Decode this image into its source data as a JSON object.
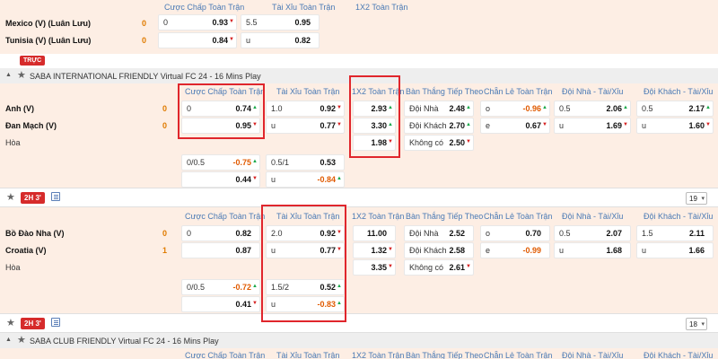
{
  "top_headers": {
    "hdcp": "Cược Chấp Toàn Trận",
    "ou": "Tài Xỉu Toàn Trận",
    "x12": "1X2 Toàn Trận"
  },
  "match0": {
    "home": "Mexico (V) (Luân Lưu)",
    "away": "Tunisia (V) (Luân Lưu)",
    "home_score": "0",
    "away_score": "0",
    "hdcp": [
      {
        "l": "0",
        "r": "0.93"
      },
      {
        "l": "",
        "r": "0.84"
      }
    ],
    "ou": [
      {
        "l": "5.5",
        "r": "0.95"
      },
      {
        "l": "u",
        "r": "0.82"
      }
    ]
  },
  "live_badge": "TRỰC",
  "league1": "SABA INTERNATIONAL FRIENDLY Virtual FC 24 - 16 Mins Play",
  "headers": {
    "hdcp": "Cược Chấp Toàn Trận",
    "ou": "Tài Xỉu Toàn Trận",
    "x12": "1X2 Toàn Trận",
    "next": "Bàn Thắng Tiếp Theo",
    "oe": "Chẵn Lẻ Toàn Trận",
    "home_ou": "Đội Nhà - Tài/Xỉu",
    "away_ou": "Đội Khách - Tài/Xỉu"
  },
  "match1": {
    "home": "Anh (V)",
    "away": "Đan Mạch (V)",
    "draw": "Hòa",
    "home_score": "0",
    "away_score": "0",
    "hdcp": [
      {
        "l": "0",
        "r": "0.74"
      },
      {
        "l": "",
        "r": "0.95"
      }
    ],
    "ou": [
      {
        "l": "1.0",
        "r": "0.92"
      },
      {
        "l": "u",
        "r": "0.77"
      }
    ],
    "x12": [
      "2.93",
      "3.30",
      "1.98"
    ],
    "next": [
      {
        "l": "Đội Nhà",
        "r": "2.48"
      },
      {
        "l": "Đội Khách",
        "r": "2.70"
      },
      {
        "l": "Không có",
        "r": "2.50"
      }
    ],
    "oe": [
      {
        "l": "o",
        "r": "-0.96"
      },
      {
        "l": "e",
        "r": "0.67"
      }
    ],
    "home_ou": [
      {
        "l": "0.5",
        "r": "2.06"
      },
      {
        "l": "u",
        "r": "1.69"
      }
    ],
    "away_ou": [
      {
        "l": "0.5",
        "r": "2.17"
      },
      {
        "l": "u",
        "r": "1.60"
      }
    ],
    "hdcp2": [
      {
        "l": "0/0.5",
        "r": "-0.75"
      },
      {
        "l": "",
        "r": "0.44"
      }
    ],
    "ou2": [
      {
        "l": "0.5/1",
        "r": "0.53"
      },
      {
        "l": "u",
        "r": "-0.84"
      }
    ]
  },
  "bar1": {
    "time": "2H 3'",
    "count": "19"
  },
  "match2": {
    "home": "Bồ Đào Nha (V)",
    "away": "Croatia (V)",
    "draw": "Hòa",
    "home_score": "0",
    "away_score": "1",
    "hdcp": [
      {
        "l": "0",
        "r": "0.82"
      },
      {
        "l": "",
        "r": "0.87"
      }
    ],
    "ou": [
      {
        "l": "2.0",
        "r": "0.92"
      },
      {
        "l": "u",
        "r": "0.77"
      }
    ],
    "x12": [
      "11.00",
      "1.32",
      "3.35"
    ],
    "next": [
      {
        "l": "Đội Nhà",
        "r": "2.52"
      },
      {
        "l": "Đội Khách",
        "r": "2.58"
      },
      {
        "l": "Không có",
        "r": "2.61"
      }
    ],
    "oe": [
      {
        "l": "o",
        "r": "0.70"
      },
      {
        "l": "e",
        "r": "-0.99"
      }
    ],
    "home_ou": [
      {
        "l": "0.5",
        "r": "2.07"
      },
      {
        "l": "u",
        "r": "1.68"
      }
    ],
    "away_ou": [
      {
        "l": "1.5",
        "r": "2.11"
      },
      {
        "l": "u",
        "r": "1.66"
      }
    ],
    "hdcp2": [
      {
        "l": "0/0.5",
        "r": "-0.72"
      },
      {
        "l": "",
        "r": "0.41"
      }
    ],
    "ou2": [
      {
        "l": "1.5/2",
        "r": "0.52"
      },
      {
        "l": "u",
        "r": "-0.83"
      }
    ]
  },
  "bar2": {
    "time": "2H 3'",
    "count": "18"
  },
  "league2": "SABA CLUB FRIENDLY Virtual FC 24 - 16 Mins Play",
  "colors": {
    "accent_red": "#e0262c",
    "up": "#1aa84a",
    "down": "#d62020",
    "band": "#fdeee4"
  }
}
